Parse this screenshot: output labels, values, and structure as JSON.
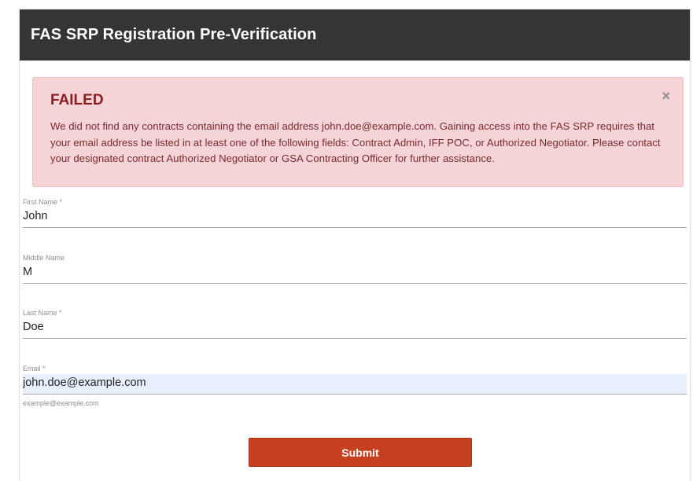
{
  "header": {
    "title": "FAS SRP Registration Pre-Verification"
  },
  "alert": {
    "title": "FAILED",
    "message": "We did not find any contracts containing the email address john.doe@example.com. Gaining access into the FAS SRP requires that your email address be listed in at least one of the following fields: Contract Admin, IFF POC, or Authorized Negotiator. Please contact your designated contract Authorized Negotiator or GSA Contracting Officer for further assistance.",
    "close_glyph": "×",
    "background_color": "#f5d4d8",
    "title_color": "#8b1d24"
  },
  "form": {
    "first_name": {
      "label": "First Name *",
      "value": "John"
    },
    "middle_name": {
      "label": "Middle Name",
      "value": "M"
    },
    "last_name": {
      "label": "Last Name *",
      "value": "Doe"
    },
    "email": {
      "label": "Email *",
      "value": "john.doe@example.com",
      "hint": "example@example.com"
    },
    "submit_label": "Submit"
  },
  "colors": {
    "header_bg": "#353535",
    "submit_bg": "#c4401f"
  }
}
